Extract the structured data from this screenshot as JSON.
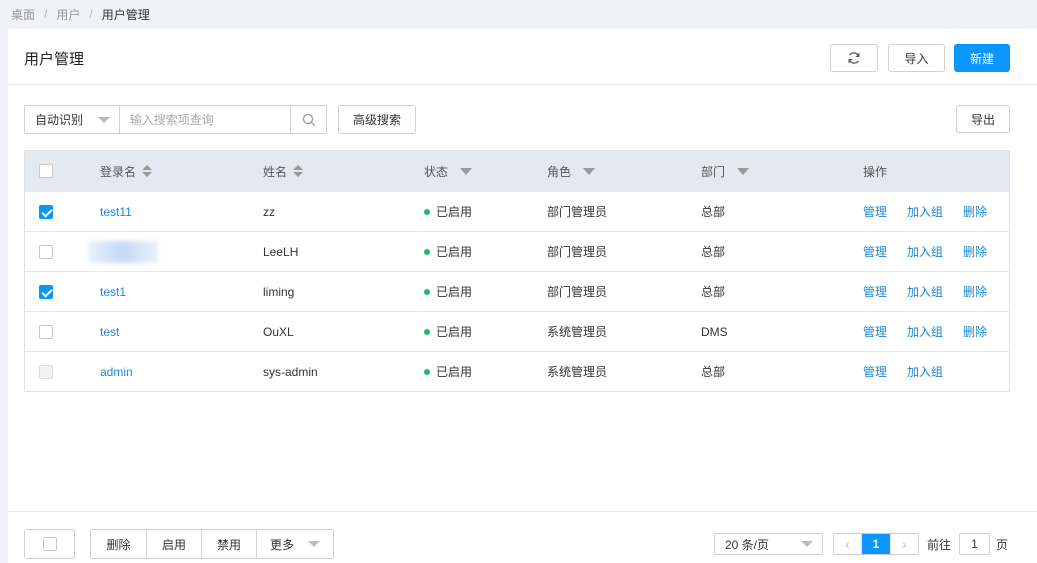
{
  "breadcrumb": [
    "桌面",
    "用户",
    "用户管理"
  ],
  "header": {
    "title": "用户管理",
    "import_label": "导入",
    "new_label": "新建"
  },
  "toolbar": {
    "search_mode": "自动识别",
    "search_placeholder": "输入搜索项查询",
    "advanced_label": "高级搜索",
    "export_label": "导出"
  },
  "table": {
    "columns": {
      "login": "登录名",
      "name": "姓名",
      "status": "状态",
      "role": "角色",
      "dept": "部门",
      "actions": "操作"
    },
    "rows": [
      {
        "checked": true,
        "login": "test11",
        "name": "zz",
        "status": "已启用",
        "role": "部门管理员",
        "dept": "总部",
        "actions": [
          "管理",
          "加入组",
          "删除"
        ]
      },
      {
        "checked": false,
        "login": "",
        "name": "LeeLH",
        "status": "已启用",
        "role": "部门管理员",
        "dept": "总部",
        "actions": [
          "管理",
          "加入组",
          "删除"
        ]
      },
      {
        "checked": true,
        "login": "test1",
        "name": "liming",
        "status": "已启用",
        "role": "部门管理员",
        "dept": "总部",
        "actions": [
          "管理",
          "加入组",
          "删除"
        ]
      },
      {
        "checked": false,
        "login": "test",
        "name": "OuXL",
        "status": "已启用",
        "role": "系统管理员",
        "dept": "DMS",
        "actions": [
          "管理",
          "加入组",
          "删除"
        ]
      },
      {
        "checked": false,
        "disabled": true,
        "login": "admin",
        "name": "sys-admin",
        "status": "已启用",
        "role": "系统管理员",
        "dept": "总部",
        "actions": [
          "管理",
          "加入组"
        ]
      }
    ]
  },
  "footer": {
    "batch_buttons": [
      "删除",
      "启用",
      "禁用",
      "更多"
    ],
    "page_size": "20 条/页",
    "current_page": "1",
    "goto_prefix": "前往",
    "goto_value": "1",
    "goto_suffix": "页"
  },
  "colors": {
    "primary": "#0a95ff",
    "link": "#1a88d6",
    "status_active": "#1cbc6c",
    "table_header": "#e4e9f1"
  },
  "icons": [
    "refresh-icon",
    "search-icon",
    "sort-icon",
    "filter-icon",
    "chevron-left-icon",
    "chevron-right-icon"
  ]
}
